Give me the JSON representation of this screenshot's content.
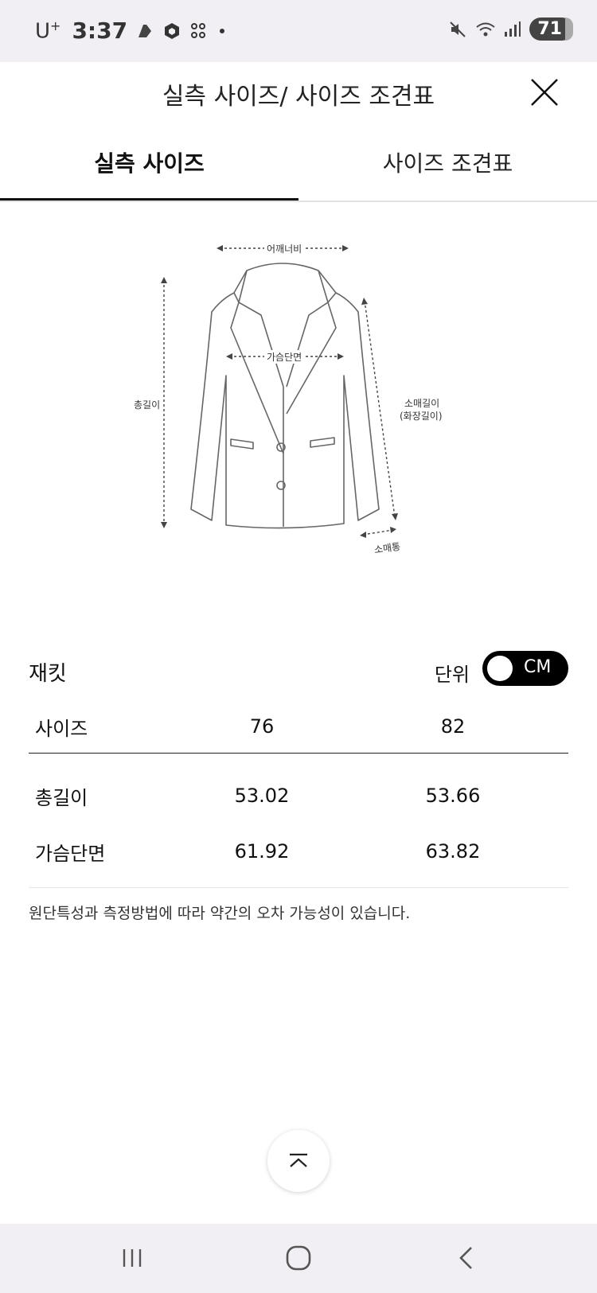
{
  "status_bar": {
    "carrier": "U",
    "carrier_sup": "+",
    "time": "3:37",
    "battery": "71"
  },
  "header": {
    "title": "실측 사이즈/ 사이즈 조견표"
  },
  "tabs": [
    {
      "label": "실측 사이즈",
      "active": true
    },
    {
      "label": "사이즈 조견표",
      "active": false
    }
  ],
  "diagram": {
    "labels": {
      "shoulder": "어깨너비",
      "chest": "가슴단면",
      "total_length": "총길이",
      "sleeve": "소매길이",
      "sleeve_sub": "(화장길이)",
      "cuff": "소매통"
    }
  },
  "table": {
    "category": "재킷",
    "unit_label": "단위",
    "unit_value": "CM",
    "headers": [
      "사이즈",
      "76",
      "82"
    ],
    "rows": [
      {
        "label": "총길이",
        "values": [
          "53.02",
          "53.66"
        ]
      },
      {
        "label": "가슴단면",
        "values": [
          "61.92",
          "63.82"
        ]
      }
    ],
    "note": "원단특성과 측정방법에 따라 약간의 오차 가능성이 있습니다."
  },
  "colors": {
    "status_bg": "#f1eff4",
    "toggle_bg": "#000000"
  }
}
